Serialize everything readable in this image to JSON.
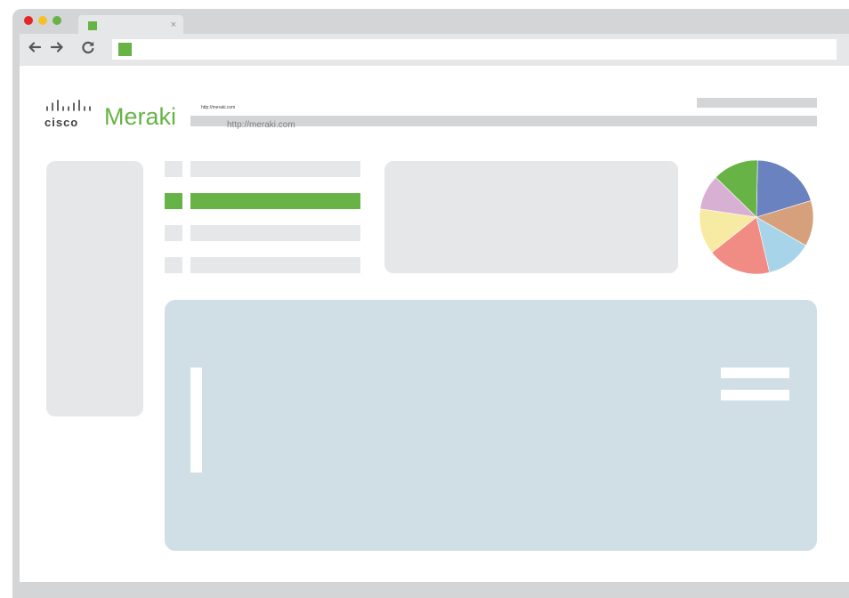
{
  "browser": {
    "window_controls": [
      {
        "name": "close",
        "color": "#e32726"
      },
      {
        "name": "minimize",
        "color": "#f5c12b"
      },
      {
        "name": "maximize",
        "color": "#67b346"
      }
    ],
    "tab": {
      "close_glyph": "×",
      "favicon_color": "#67b346"
    },
    "nav": {
      "back_glyph": "←",
      "forward_glyph": "→",
      "reload_glyph": "C"
    },
    "address_bar": {
      "favicon_color": "#67b346"
    }
  },
  "header": {
    "logo": {
      "cisco": "cisco",
      "meraki": "Meraki"
    },
    "url_small": "http://meraki.com",
    "url_large": "http://meraki.com"
  },
  "menu": {
    "items": [
      {
        "active": false
      },
      {
        "active": true
      },
      {
        "active": false
      },
      {
        "active": false
      }
    ],
    "active_color": "#67b346",
    "inactive_color": "#e6e7e8"
  },
  "pie_chart": {
    "slices": [
      {
        "value": 20,
        "color": "#6a82c0"
      },
      {
        "value": 13,
        "color": "#d6a07c"
      },
      {
        "value": 13,
        "color": "#a8d4ea"
      },
      {
        "value": 18,
        "color": "#f08c84"
      },
      {
        "value": 13,
        "color": "#f7eaa2"
      },
      {
        "value": 10,
        "color": "#d8b0d3"
      },
      {
        "value": 13,
        "color": "#67b346"
      }
    ]
  },
  "colors": {
    "accent": "#67b346",
    "placeholder": "#e6e7e8",
    "panel": "#d0dfe6",
    "chrome": "#d4d5d7"
  }
}
